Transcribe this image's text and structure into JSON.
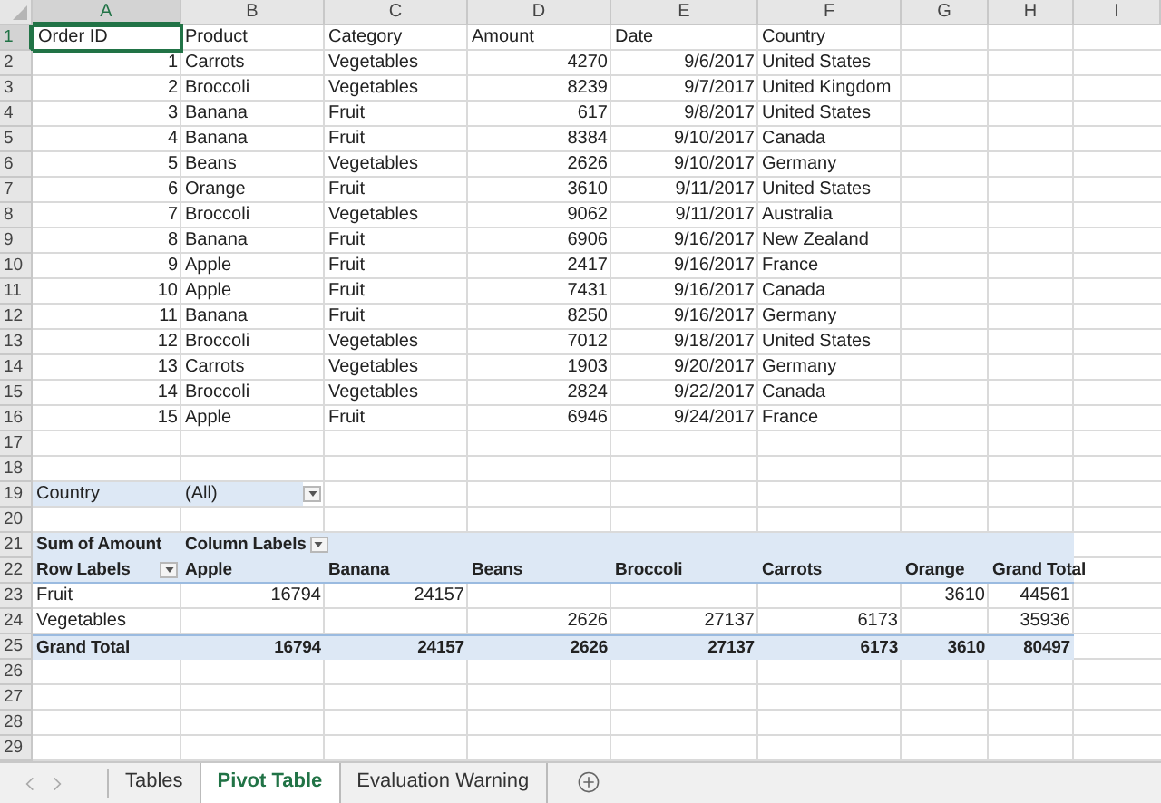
{
  "columns": [
    {
      "label": "A",
      "selected": true
    },
    {
      "label": "B",
      "selected": false
    },
    {
      "label": "C",
      "selected": false
    },
    {
      "label": "D",
      "selected": false
    },
    {
      "label": "E",
      "selected": false
    },
    {
      "label": "F",
      "selected": false
    },
    {
      "label": "G",
      "selected": false
    },
    {
      "label": "H",
      "selected": false
    },
    {
      "label": "I",
      "selected": false
    }
  ],
  "rows": [
    {
      "number": "1",
      "selected": true,
      "kind": "data",
      "cells": [
        {
          "text": "Order ID",
          "kind": "text"
        },
        {
          "text": "Product",
          "kind": "text"
        },
        {
          "text": "Category",
          "kind": "text"
        },
        {
          "text": "Amount",
          "kind": "text"
        },
        {
          "text": "Date",
          "kind": "text"
        },
        {
          "text": "Country",
          "kind": "text"
        }
      ]
    },
    {
      "number": "2",
      "selected": false,
      "kind": "data",
      "cells": [
        {
          "text": "1",
          "kind": "number"
        },
        {
          "text": "Carrots",
          "kind": "text"
        },
        {
          "text": "Vegetables",
          "kind": "text"
        },
        {
          "text": "4270",
          "kind": "number"
        },
        {
          "text": "9/6/2017",
          "kind": "number"
        },
        {
          "text": "United States",
          "kind": "text"
        }
      ]
    },
    {
      "number": "3",
      "selected": false,
      "kind": "data",
      "cells": [
        {
          "text": "2",
          "kind": "number"
        },
        {
          "text": "Broccoli",
          "kind": "text"
        },
        {
          "text": "Vegetables",
          "kind": "text"
        },
        {
          "text": "8239",
          "kind": "number"
        },
        {
          "text": "9/7/2017",
          "kind": "number"
        },
        {
          "text": "United Kingdom",
          "kind": "text"
        }
      ]
    },
    {
      "number": "4",
      "selected": false,
      "kind": "data",
      "cells": [
        {
          "text": "3",
          "kind": "number"
        },
        {
          "text": "Banana",
          "kind": "text"
        },
        {
          "text": "Fruit",
          "kind": "text"
        },
        {
          "text": "617",
          "kind": "number"
        },
        {
          "text": "9/8/2017",
          "kind": "number"
        },
        {
          "text": "United States",
          "kind": "text"
        }
      ]
    },
    {
      "number": "5",
      "selected": false,
      "kind": "data",
      "cells": [
        {
          "text": "4",
          "kind": "number"
        },
        {
          "text": "Banana",
          "kind": "text"
        },
        {
          "text": "Fruit",
          "kind": "text"
        },
        {
          "text": "8384",
          "kind": "number"
        },
        {
          "text": "9/10/2017",
          "kind": "number"
        },
        {
          "text": "Canada",
          "kind": "text"
        }
      ]
    },
    {
      "number": "6",
      "selected": false,
      "kind": "data",
      "cells": [
        {
          "text": "5",
          "kind": "number"
        },
        {
          "text": "Beans",
          "kind": "text"
        },
        {
          "text": "Vegetables",
          "kind": "text"
        },
        {
          "text": "2626",
          "kind": "number"
        },
        {
          "text": "9/10/2017",
          "kind": "number"
        },
        {
          "text": "Germany",
          "kind": "text"
        }
      ]
    },
    {
      "number": "7",
      "selected": false,
      "kind": "data",
      "cells": [
        {
          "text": "6",
          "kind": "number"
        },
        {
          "text": "Orange",
          "kind": "text"
        },
        {
          "text": "Fruit",
          "kind": "text"
        },
        {
          "text": "3610",
          "kind": "number"
        },
        {
          "text": "9/11/2017",
          "kind": "number"
        },
        {
          "text": "United States",
          "kind": "text"
        }
      ]
    },
    {
      "number": "8",
      "selected": false,
      "kind": "data",
      "cells": [
        {
          "text": "7",
          "kind": "number"
        },
        {
          "text": "Broccoli",
          "kind": "text"
        },
        {
          "text": "Vegetables",
          "kind": "text"
        },
        {
          "text": "9062",
          "kind": "number"
        },
        {
          "text": "9/11/2017",
          "kind": "number"
        },
        {
          "text": "Australia",
          "kind": "text"
        }
      ]
    },
    {
      "number": "9",
      "selected": false,
      "kind": "data",
      "cells": [
        {
          "text": "8",
          "kind": "number"
        },
        {
          "text": "Banana",
          "kind": "text"
        },
        {
          "text": "Fruit",
          "kind": "text"
        },
        {
          "text": "6906",
          "kind": "number"
        },
        {
          "text": "9/16/2017",
          "kind": "number"
        },
        {
          "text": "New Zealand",
          "kind": "text"
        }
      ]
    },
    {
      "number": "10",
      "selected": false,
      "kind": "data",
      "cells": [
        {
          "text": "9",
          "kind": "number"
        },
        {
          "text": "Apple",
          "kind": "text"
        },
        {
          "text": "Fruit",
          "kind": "text"
        },
        {
          "text": "2417",
          "kind": "number"
        },
        {
          "text": "9/16/2017",
          "kind": "number"
        },
        {
          "text": "France",
          "kind": "text"
        }
      ]
    },
    {
      "number": "11",
      "selected": false,
      "kind": "data",
      "cells": [
        {
          "text": "10",
          "kind": "number"
        },
        {
          "text": "Apple",
          "kind": "text"
        },
        {
          "text": "Fruit",
          "kind": "text"
        },
        {
          "text": "7431",
          "kind": "number"
        },
        {
          "text": "9/16/2017",
          "kind": "number"
        },
        {
          "text": "Canada",
          "kind": "text"
        }
      ]
    },
    {
      "number": "12",
      "selected": false,
      "kind": "data",
      "cells": [
        {
          "text": "11",
          "kind": "number"
        },
        {
          "text": "Banana",
          "kind": "text"
        },
        {
          "text": "Fruit",
          "kind": "text"
        },
        {
          "text": "8250",
          "kind": "number"
        },
        {
          "text": "9/16/2017",
          "kind": "number"
        },
        {
          "text": "Germany",
          "kind": "text"
        }
      ]
    },
    {
      "number": "13",
      "selected": false,
      "kind": "data",
      "cells": [
        {
          "text": "12",
          "kind": "number"
        },
        {
          "text": "Broccoli",
          "kind": "text"
        },
        {
          "text": "Vegetables",
          "kind": "text"
        },
        {
          "text": "7012",
          "kind": "number"
        },
        {
          "text": "9/18/2017",
          "kind": "number"
        },
        {
          "text": "United States",
          "kind": "text"
        }
      ]
    },
    {
      "number": "14",
      "selected": false,
      "kind": "data",
      "cells": [
        {
          "text": "13",
          "kind": "number"
        },
        {
          "text": "Carrots",
          "kind": "text"
        },
        {
          "text": "Vegetables",
          "kind": "text"
        },
        {
          "text": "1903",
          "kind": "number"
        },
        {
          "text": "9/20/2017",
          "kind": "number"
        },
        {
          "text": "Germany",
          "kind": "text"
        }
      ]
    },
    {
      "number": "15",
      "selected": false,
      "kind": "data",
      "cells": [
        {
          "text": "14",
          "kind": "number"
        },
        {
          "text": "Broccoli",
          "kind": "text"
        },
        {
          "text": "Vegetables",
          "kind": "text"
        },
        {
          "text": "2824",
          "kind": "number"
        },
        {
          "text": "9/22/2017",
          "kind": "number"
        },
        {
          "text": "Canada",
          "kind": "text"
        }
      ]
    },
    {
      "number": "16",
      "selected": false,
      "kind": "data",
      "cells": [
        {
          "text": "15",
          "kind": "number"
        },
        {
          "text": "Apple",
          "kind": "text"
        },
        {
          "text": "Fruit",
          "kind": "text"
        },
        {
          "text": "6946",
          "kind": "number"
        },
        {
          "text": "9/24/2017",
          "kind": "number"
        },
        {
          "text": "France",
          "kind": "text"
        }
      ]
    },
    {
      "number": "17",
      "selected": false,
      "kind": "data"
    },
    {
      "number": "18",
      "selected": false,
      "kind": "data"
    },
    {
      "number": "19",
      "selected": false,
      "kind": "filter",
      "cells": [
        {
          "text": "Country",
          "kind": "text"
        },
        {
          "text": "(All)",
          "kind": "text",
          "dropdown": true
        }
      ]
    },
    {
      "number": "20",
      "selected": false,
      "kind": "data"
    },
    {
      "number": "21",
      "selected": false,
      "kind": "pivot-header",
      "cells": [
        {
          "text": "Sum of Amount",
          "kind": "text"
        },
        {
          "text": "Column Labels",
          "kind": "text",
          "dropdown": true
        }
      ]
    },
    {
      "number": "22",
      "selected": false,
      "kind": "pivot-header",
      "cells": [
        {
          "text": "Row Labels",
          "kind": "text",
          "dropdown": true
        },
        {
          "text": "Apple",
          "kind": "text"
        },
        {
          "text": "Banana",
          "kind": "text"
        },
        {
          "text": "Beans",
          "kind": "text"
        },
        {
          "text": "Broccoli",
          "kind": "text"
        },
        {
          "text": "Carrots",
          "kind": "text"
        },
        {
          "text": "Orange",
          "kind": "text"
        },
        {
          "text": "Grand Total",
          "kind": "text"
        }
      ]
    },
    {
      "number": "23",
      "selected": false,
      "kind": "pivot-body",
      "cells": [
        {
          "text": "Fruit",
          "kind": "text"
        },
        {
          "text": "16794",
          "kind": "number"
        },
        {
          "text": "24157",
          "kind": "number"
        },
        null,
        null,
        null,
        {
          "text": "3610",
          "kind": "number"
        },
        {
          "text": "44561",
          "kind": "number"
        }
      ]
    },
    {
      "number": "24",
      "selected": false,
      "kind": "pivot-body",
      "cells": [
        {
          "text": "Vegetables",
          "kind": "text"
        },
        null,
        null,
        {
          "text": "2626",
          "kind": "number"
        },
        {
          "text": "27137",
          "kind": "number"
        },
        {
          "text": "6173",
          "kind": "number"
        },
        null,
        {
          "text": "35936",
          "kind": "number"
        }
      ]
    },
    {
      "number": "25",
      "selected": false,
      "kind": "pivot-total",
      "cells": [
        {
          "text": "Grand Total",
          "kind": "text"
        },
        {
          "text": "16794",
          "kind": "number"
        },
        {
          "text": "24157",
          "kind": "number"
        },
        {
          "text": "2626",
          "kind": "number"
        },
        {
          "text": "27137",
          "kind": "number"
        },
        {
          "text": "6173",
          "kind": "number"
        },
        {
          "text": "3610",
          "kind": "number"
        },
        {
          "text": "80497",
          "kind": "number"
        }
      ]
    },
    {
      "number": "26",
      "selected": false,
      "kind": "data"
    },
    {
      "number": "27",
      "selected": false,
      "kind": "data"
    },
    {
      "number": "28",
      "selected": false,
      "kind": "data"
    },
    {
      "number": "29",
      "selected": false,
      "kind": "data"
    }
  ],
  "sheet_tabs": [
    {
      "label": "Tables",
      "selected": false
    },
    {
      "label": "Pivot Table",
      "selected": true
    },
    {
      "label": "Evaluation Warning",
      "selected": false
    }
  ]
}
